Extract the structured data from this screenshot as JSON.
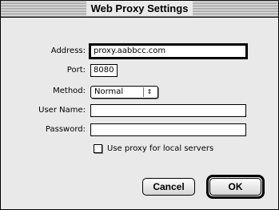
{
  "window": {
    "title": "Web Proxy Settings"
  },
  "form": {
    "address_label": "Address:",
    "address_value": "proxy.aabbcc.com",
    "port_label": "Port:",
    "port_value": "8080",
    "method_label": "Method:",
    "method_value": "Normal",
    "username_label": "User Name:",
    "username_value": "",
    "password_label": "Password:",
    "password_value": "",
    "local_checkbox_label": "Use proxy for local servers",
    "local_checkbox_checked": false
  },
  "buttons": {
    "cancel_label": "Cancel",
    "ok_label": "OK"
  },
  "icons": {
    "popup_arrow": "up-down-arrows-icon"
  }
}
